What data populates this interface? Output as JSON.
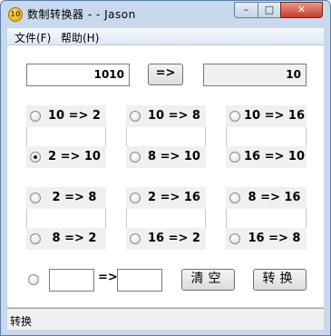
{
  "window": {
    "icon_text": "10",
    "title": "数制转换器 - - Jason",
    "minimize": "–",
    "maximize": "□",
    "close": "✕"
  },
  "menu": {
    "file": "文件(F)",
    "help": "帮助(H)"
  },
  "converter": {
    "input_value": "1010",
    "convert_arrow_button": "=>",
    "output_value": "10"
  },
  "radio_group_1": [
    {
      "label": "10 => 2",
      "checked": false
    },
    {
      "label": "10 => 8",
      "checked": false
    },
    {
      "label": "10 => 16",
      "checked": false
    },
    {
      "label": "2 => 10",
      "checked": true
    },
    {
      "label": "8 => 10",
      "checked": false
    },
    {
      "label": "16 => 10",
      "checked": false
    }
  ],
  "radio_group_2": [
    {
      "label": "2 => 8",
      "checked": false
    },
    {
      "label": "2 => 16",
      "checked": false
    },
    {
      "label": "8 => 16",
      "checked": false
    },
    {
      "label": "8 => 2",
      "checked": false
    },
    {
      "label": "16 => 2",
      "checked": false
    },
    {
      "label": "16 => 8",
      "checked": false
    }
  ],
  "custom": {
    "from_base": "",
    "arrow": "=>",
    "to_base": "",
    "clear_button": "清空",
    "convert_button": "转换"
  },
  "status": {
    "text": "转换"
  }
}
